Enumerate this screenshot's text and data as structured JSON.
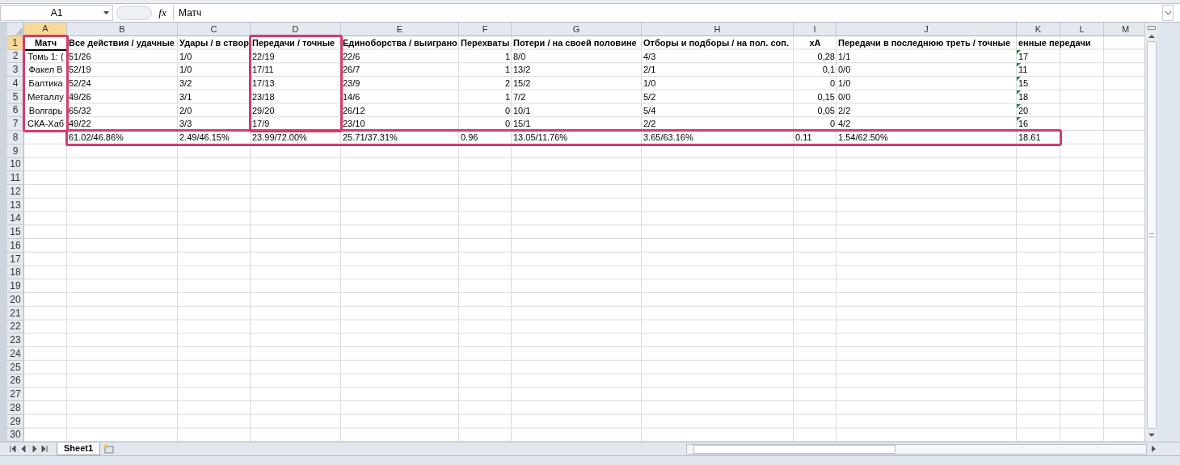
{
  "formula_bar": {
    "name_box": "A1",
    "function_button": "fx",
    "formula": "Матч"
  },
  "columns": [
    {
      "label": "A",
      "selected": true
    },
    {
      "label": "B",
      "selected": false
    },
    {
      "label": "C",
      "selected": false
    },
    {
      "label": "D",
      "selected": false
    },
    {
      "label": "E",
      "selected": false
    },
    {
      "label": "F",
      "selected": false
    },
    {
      "label": "G",
      "selected": false
    },
    {
      "label": "H",
      "selected": false
    },
    {
      "label": "I",
      "selected": false
    },
    {
      "label": "J",
      "selected": false
    },
    {
      "label": "K",
      "selected": false
    },
    {
      "label": "L",
      "selected": false
    },
    {
      "label": "M",
      "selected": false
    }
  ],
  "rows": [
    {
      "number": "1",
      "selected": true,
      "cells": [
        {
          "text": "Матч",
          "kind": "label",
          "bold": true,
          "active": true
        },
        {
          "text": "Все действия / удачные",
          "bold": true
        },
        {
          "text": "Удары / в створ",
          "bold": true
        },
        {
          "text": "Передачи / точные",
          "bold": true
        },
        {
          "text": "Единоборства / выиграно",
          "bold": true
        },
        {
          "text": "Перехваты",
          "bold": true
        },
        {
          "text": "Потери / на своей половине",
          "bold": true
        },
        {
          "text": "Отборы и подборы / на пол. соп.",
          "bold": true
        },
        {
          "text": "xA",
          "kind": "label",
          "bold": true
        },
        {
          "text": "Передачи в последнюю треть / точные",
          "bold": true
        },
        {
          "text": "енные передачи",
          "bold": true
        }
      ]
    },
    {
      "number": "2",
      "selected": false,
      "cells": [
        {
          "text": "Томь  1: (",
          "kind": "label"
        },
        {
          "text": "51/26"
        },
        {
          "text": "1/0"
        },
        {
          "text": "22/19"
        },
        {
          "text": "22/6"
        },
        {
          "text": "1",
          "kind": "number"
        },
        {
          "text": "8/0"
        },
        {
          "text": "4/3"
        },
        {
          "text": "0,28",
          "kind": "number"
        },
        {
          "text": "1/1"
        },
        {
          "text": "17",
          "flag": true
        }
      ]
    },
    {
      "number": "3",
      "selected": false,
      "cells": [
        {
          "text": "Факел В",
          "kind": "label"
        },
        {
          "text": "52/19"
        },
        {
          "text": "1/0"
        },
        {
          "text": "17/11"
        },
        {
          "text": "26/7"
        },
        {
          "text": "1",
          "kind": "number"
        },
        {
          "text": "13/2"
        },
        {
          "text": "2/1"
        },
        {
          "text": "0,1",
          "kind": "number"
        },
        {
          "text": "0/0"
        },
        {
          "text": "11",
          "flag": true
        }
      ]
    },
    {
      "number": "4",
      "selected": false,
      "cells": [
        {
          "text": "Балтика",
          "kind": "label"
        },
        {
          "text": "52/24"
        },
        {
          "text": "3/2"
        },
        {
          "text": "17/13"
        },
        {
          "text": "23/9"
        },
        {
          "text": "2",
          "kind": "number"
        },
        {
          "text": "15/2"
        },
        {
          "text": "1/0"
        },
        {
          "text": "0",
          "kind": "number"
        },
        {
          "text": "1/0"
        },
        {
          "text": "15",
          "flag": true
        }
      ]
    },
    {
      "number": "5",
      "selected": false,
      "cells": [
        {
          "text": "Металлу",
          "kind": "label"
        },
        {
          "text": "49/26"
        },
        {
          "text": "3/1"
        },
        {
          "text": "23/18"
        },
        {
          "text": "14/6"
        },
        {
          "text": "1",
          "kind": "number"
        },
        {
          "text": "7/2"
        },
        {
          "text": "5/2"
        },
        {
          "text": "0,15",
          "kind": "number"
        },
        {
          "text": "0/0"
        },
        {
          "text": "18",
          "flag": true
        }
      ]
    },
    {
      "number": "6",
      "selected": false,
      "cells": [
        {
          "text": "Волгарь",
          "kind": "label"
        },
        {
          "text": "65/32"
        },
        {
          "text": "2/0"
        },
        {
          "text": "29/20"
        },
        {
          "text": "26/12"
        },
        {
          "text": "0",
          "kind": "number"
        },
        {
          "text": "10/1"
        },
        {
          "text": "5/4"
        },
        {
          "text": "0,05",
          "kind": "number"
        },
        {
          "text": "2/2"
        },
        {
          "text": "20",
          "flag": true
        }
      ]
    },
    {
      "number": "7",
      "selected": false,
      "cells": [
        {
          "text": "СКА-Хаб",
          "kind": "label"
        },
        {
          "text": "49/22"
        },
        {
          "text": "3/3"
        },
        {
          "text": "17/9"
        },
        {
          "text": "23/10"
        },
        {
          "text": "0",
          "kind": "number"
        },
        {
          "text": "15/1"
        },
        {
          "text": "2/2"
        },
        {
          "text": "0",
          "kind": "number"
        },
        {
          "text": "4/2"
        },
        {
          "text": "16",
          "flag": true
        }
      ]
    },
    {
      "number": "8",
      "selected": false,
      "cells": [
        {
          "text": ""
        },
        {
          "text": "61.02/46.86%"
        },
        {
          "text": "2.49/46.15%"
        },
        {
          "text": "23.99/72.00%"
        },
        {
          "text": "25.71/37.31%"
        },
        {
          "text": "0.96"
        },
        {
          "text": "13.05/11.76%"
        },
        {
          "text": "3.65/63.16%"
        },
        {
          "text": "0.11"
        },
        {
          "text": "1.54/62.50%"
        },
        {
          "text": "18.61"
        }
      ]
    },
    {
      "number": "9",
      "selected": false,
      "cells": []
    },
    {
      "number": "10",
      "selected": false,
      "cells": []
    },
    {
      "number": "11",
      "selected": false,
      "cells": []
    },
    {
      "number": "12",
      "selected": false,
      "cells": []
    },
    {
      "number": "13",
      "selected": false,
      "cells": []
    },
    {
      "number": "14",
      "selected": false,
      "cells": []
    },
    {
      "number": "15",
      "selected": false,
      "cells": []
    },
    {
      "number": "16",
      "selected": false,
      "cells": []
    },
    {
      "number": "17",
      "selected": false,
      "cells": []
    },
    {
      "number": "18",
      "selected": false,
      "cells": []
    },
    {
      "number": "19",
      "selected": false,
      "cells": []
    },
    {
      "number": "20",
      "selected": false,
      "cells": []
    },
    {
      "number": "21",
      "selected": false,
      "cells": []
    },
    {
      "number": "22",
      "selected": false,
      "cells": []
    },
    {
      "number": "23",
      "selected": false,
      "cells": []
    },
    {
      "number": "24",
      "selected": false,
      "cells": []
    },
    {
      "number": "25",
      "selected": false,
      "cells": []
    },
    {
      "number": "26",
      "selected": false,
      "cells": []
    },
    {
      "number": "27",
      "selected": false,
      "cells": []
    },
    {
      "number": "28",
      "selected": false,
      "cells": []
    },
    {
      "number": "29",
      "selected": false,
      "cells": []
    },
    {
      "number": "30",
      "selected": false,
      "cells": []
    }
  ],
  "sheet_tabs": [
    {
      "label": "Sheet1",
      "selected": true
    }
  ]
}
